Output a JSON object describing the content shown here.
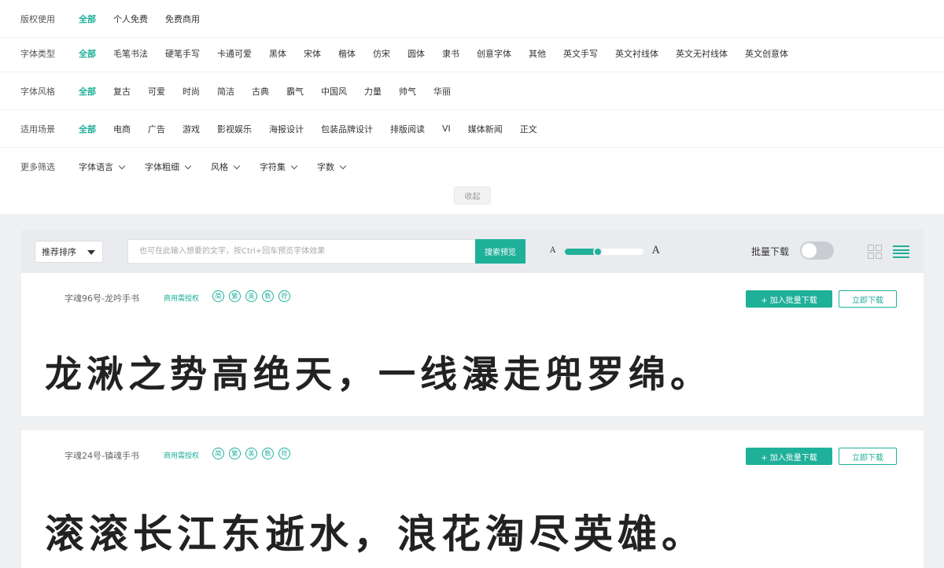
{
  "filters": {
    "row1": {
      "label": "版权使用",
      "options": [
        "全部",
        "个人免费",
        "免费商用"
      ]
    },
    "row2": {
      "label": "字体类型",
      "options": [
        "全部",
        "毛笔书法",
        "硬笔手写",
        "卡通可爱",
        "黑体",
        "宋体",
        "楷体",
        "仿宋",
        "圆体",
        "隶书",
        "创意字体",
        "其他",
        "英文手写",
        "英文衬线体",
        "英文无衬线体",
        "英文创意体"
      ]
    },
    "row3": {
      "label": "字体风格",
      "options": [
        "全部",
        "复古",
        "可爱",
        "时尚",
        "简洁",
        "古典",
        "霸气",
        "中国风",
        "力量",
        "帅气",
        "华丽"
      ]
    },
    "row4": {
      "label": "适用场景",
      "options": [
        "全部",
        "电商",
        "广告",
        "游戏",
        "影视娱乐",
        "海报设计",
        "包装品牌设计",
        "排版阅读",
        "VI",
        "媒体新闻",
        "正文"
      ]
    },
    "row5": {
      "label": "更多筛选",
      "dropdowns": [
        "字体语言",
        "字体粗细",
        "风格",
        "字符集",
        "字数"
      ]
    },
    "collapse_label": "收起"
  },
  "toolbar": {
    "sort_label": "推荐排序",
    "search_placeholder": "也可在此输入想要的文字，按Ctrl+回车预览字体效果",
    "search_button": "搜索预览",
    "size_small": "A",
    "size_large": "A",
    "size_level_percent": 42,
    "batch_label": "批量下载",
    "batch_on": false,
    "accent": "#1fb09a"
  },
  "cards": [
    {
      "font_name": "字魂96号-龙吟手书",
      "tag": "商用需授权",
      "add_label": "+ 加入批量下载",
      "download_label": "立即下载",
      "preview_text": "龙湫之势高绝天，一线瀑走兜罗绵。"
    },
    {
      "font_name": "字魂24号-镇魂手书",
      "tag": "商用需授权",
      "add_label": "+ 加入批量下载",
      "download_label": "立即下载",
      "preview_text": "滚滚长江东逝水，浪花淘尽英雄。"
    }
  ]
}
